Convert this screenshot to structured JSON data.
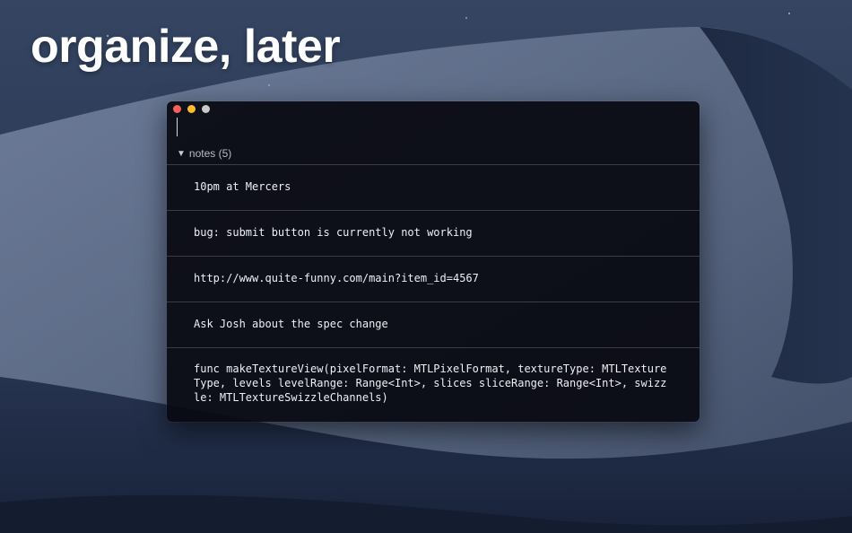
{
  "headline": "organize, later",
  "window": {
    "traffic_lights": [
      "close",
      "minimize",
      "zoom"
    ],
    "group": {
      "label": "notes (5)",
      "expanded": true
    },
    "notes": [
      "10pm at Mercers",
      "bug: submit button is currently not working",
      "http://www.quite-funny.com/main?item_id=4567",
      "Ask Josh about the spec change",
      "func makeTextureView(pixelFormat: MTLPixelFormat, textureType: MTLTextureType, levels levelRange: Range<Int>, slices sliceRange: Range<Int>, swizzle: MTLTextureSwizzleChannels)"
    ]
  },
  "colors": {
    "close": "#fc5f57",
    "minimize": "#fdbc2e",
    "zoom": "#c9c9c9"
  }
}
